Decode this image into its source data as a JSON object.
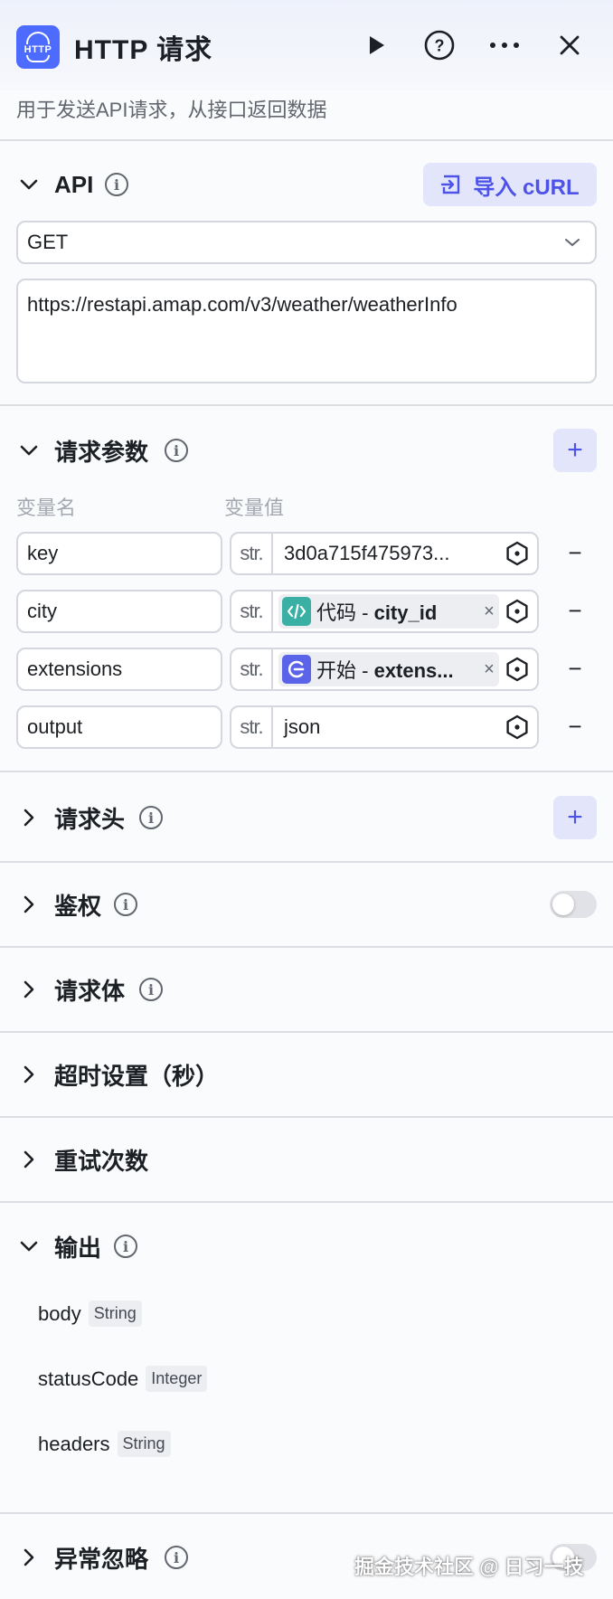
{
  "header": {
    "logo_text": "HTTP",
    "title": "HTTP 请求",
    "description": "用于发送API请求，从接口返回数据"
  },
  "api": {
    "title": "API",
    "import_button": "导入 cURL",
    "method": "GET",
    "url": "https://restapi.amap.com/v3/weather/weatherInfo"
  },
  "params": {
    "title": "请求参数",
    "add_label": "+",
    "remove_label": "−",
    "col_name": "变量名",
    "col_value": "变量值",
    "type_tag": "str.",
    "rows": [
      {
        "name": "key",
        "value": "3d0a715f475973..."
      },
      {
        "name": "city",
        "source": "代码",
        "variable": "city_id"
      },
      {
        "name": "extensions",
        "source": "开始",
        "variable": "extens..."
      },
      {
        "name": "output",
        "value": "json"
      }
    ]
  },
  "sections": {
    "headers": "请求头",
    "auth": "鉴权",
    "body": "请求体",
    "timeout": "超时设置（秒）",
    "retry": "重试次数",
    "ignore_exception": "异常忽略"
  },
  "output": {
    "title": "输出",
    "fields": [
      {
        "name": "body",
        "type": "String"
      },
      {
        "name": "statusCode",
        "type": "Integer"
      },
      {
        "name": "headers",
        "type": "String"
      }
    ]
  },
  "toggles": {
    "auth": false,
    "ignore_exception": false
  },
  "colors": {
    "accent": "#4d53e8",
    "accent_bg": "#e3e6fb",
    "code_icon": "#3ab0a4",
    "start_icon": "#5b63e8"
  },
  "watermark": "掘金技术社区 @ 日习一技"
}
